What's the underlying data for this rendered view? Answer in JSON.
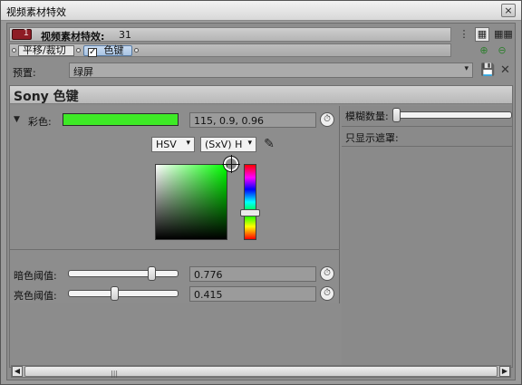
{
  "window": {
    "title": "视频素材特效",
    "close_glyph": "×"
  },
  "fxhead": {
    "icon_number": "1",
    "label": "视频素材特效:",
    "count": "31"
  },
  "view_buttons": [
    "⋮",
    "▦",
    "▦▦"
  ],
  "chain": {
    "items": [
      {
        "label": "平移/裁切"
      },
      {
        "label": "色键",
        "checked": true
      }
    ],
    "add_glyph": "⊕",
    "remove_glyph": "⊖"
  },
  "preset": {
    "label": "预置:",
    "value": "绿屏",
    "save_glyph": "💾",
    "delete_glyph": "✕"
  },
  "plugin": {
    "name": "Sony 色键",
    "color": {
      "label": "彩色:",
      "swatch_hex": "#3eea26",
      "value": "115, 0.9, 0.96",
      "model": "HSV",
      "mode": "(SxV) H"
    },
    "dark_threshold": {
      "label": "暗色阈值:",
      "value": "0.776",
      "fraction": 0.776
    },
    "bright_threshold": {
      "label": "亮色阈值:",
      "value": "0.415",
      "fraction": 0.415
    },
    "blur_amount": {
      "label": "模糊数量:"
    },
    "show_mask_only": {
      "label": "只显示遮罩:"
    }
  },
  "icons": {
    "clock": "⏱",
    "eyedropper": "✎",
    "dropdown": "▾",
    "collapse": "▼"
  }
}
